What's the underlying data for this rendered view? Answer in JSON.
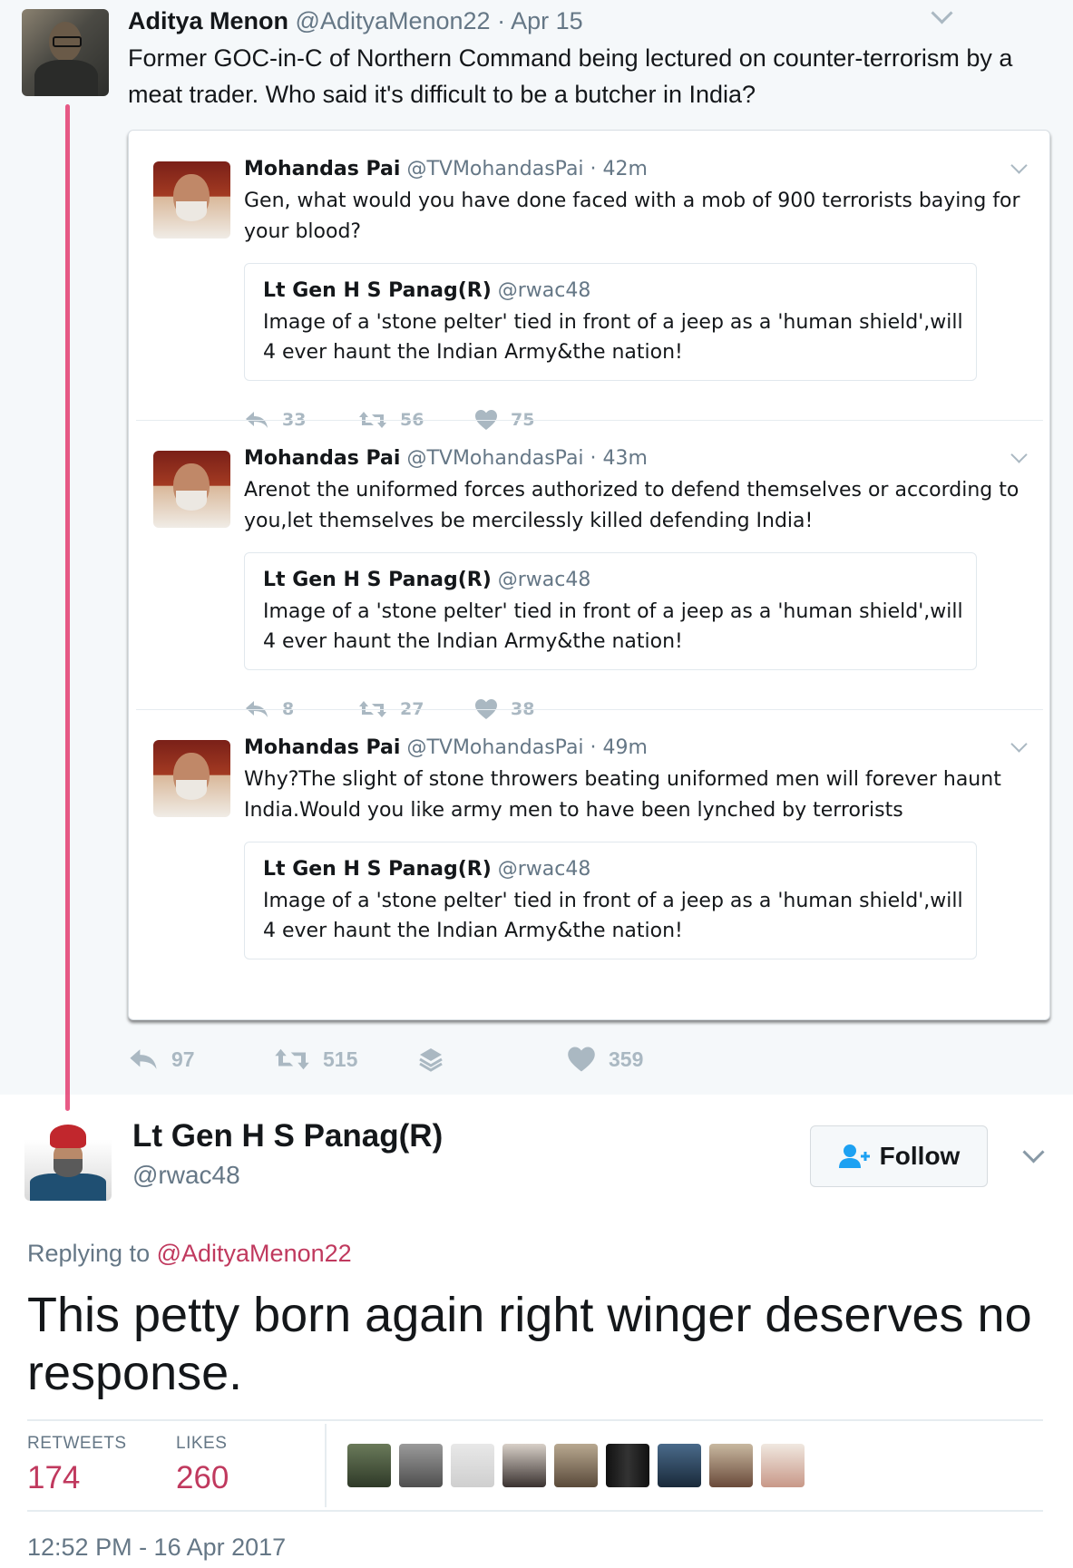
{
  "top_tweet": {
    "name": "Aditya Menon",
    "meta": "@AdityaMenon22 · Apr 15",
    "text": "Former GOC-in-C of Northern Command being lectured on counter-terrorism by a meat trader. Who said it's difficult to be a butcher in India?",
    "actions": {
      "replies": "97",
      "retweets": "515",
      "likes": "359"
    }
  },
  "embedded": {
    "tweets": [
      {
        "name": "Mohandas Pai",
        "meta": "@TVMohandasPai · 42m",
        "text": "Gen, what would you have done faced with a mob of 900 terrorists baying for your blood?",
        "quote": {
          "name": "Lt Gen H S Panag(R)",
          "handle": "@rwac48",
          "text": "Image of a 'stone pelter' tied in front of a jeep as a 'human shield',will 4 ever haunt the Indian Army&the nation!"
        },
        "replies": "33",
        "retweets": "56",
        "likes": "75"
      },
      {
        "name": "Mohandas Pai",
        "meta": "@TVMohandasPai · 43m",
        "text": "Arenot the uniformed forces authorized to defend themselves or according to you,let themselves be mercilessly killed defending India!",
        "quote": {
          "name": "Lt Gen H S Panag(R)",
          "handle": "@rwac48",
          "text": "Image of a 'stone pelter' tied in front of a jeep as a 'human shield',will 4 ever haunt the Indian Army&the nation!"
        },
        "replies": "8",
        "retweets": "27",
        "likes": "38"
      },
      {
        "name": "Mohandas Pai",
        "meta": "@TVMohandasPai · 49m",
        "text": "Why?The slight of stone throwers beating uniformed men will forever haunt India.Would you like army men to have been lynched by terrorists",
        "quote": {
          "name": "Lt Gen H S Panag(R)",
          "handle": "@rwac48",
          "text": "Image of a 'stone pelter' tied in front of a jeep as a 'human shield',will 4 ever haunt the Indian Army&the nation!"
        }
      }
    ]
  },
  "reply": {
    "name": "Lt Gen H S Panag(R)",
    "handle": "@rwac48",
    "follow_label": "Follow",
    "replying_prefix": "Replying to",
    "replying_to": "@AdityaMenon22",
    "text": "This petty born again right winger deserves no response.",
    "retweets_label": "RETWEETS",
    "retweets": "174",
    "likes_label": "LIKES",
    "likes": "260",
    "timestamp": "12:52 PM - 16 Apr 2017"
  },
  "colors": {
    "accent": "#e0245e",
    "link": "#c0395e",
    "muted": "#657786",
    "icon": "#aab8c2"
  }
}
